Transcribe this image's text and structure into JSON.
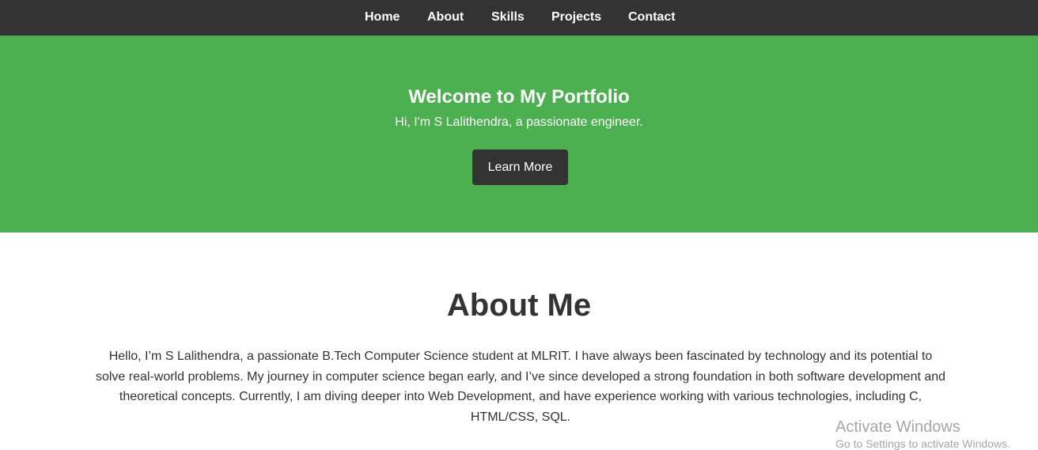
{
  "nav": {
    "items": [
      {
        "label": "Home"
      },
      {
        "label": "About"
      },
      {
        "label": "Skills"
      },
      {
        "label": "Projects"
      },
      {
        "label": "Contact"
      }
    ]
  },
  "hero": {
    "title": "Welcome to My Portfolio",
    "subtitle": "Hi, I'm S Lalithendra, a passionate engineer.",
    "button_label": "Learn More"
  },
  "about": {
    "heading": "About Me",
    "paragraph": "Hello, I’m S Lalithendra, a passionate B.Tech Computer Science student at MLRIT. I have always been fascinated by technology and its potential to solve real-world problems. My journey in computer science began early, and I’ve since developed a strong foundation in both software development and theoretical concepts. Currently, I am diving deeper into Web Development, and have experience working with various technologies, including C, HTML/CSS, SQL."
  },
  "watermark": {
    "title": "Activate Windows",
    "subtitle": "Go to Settings to activate Windows."
  },
  "colors": {
    "nav_background": "#333333",
    "hero_background": "#4caf50",
    "button_background": "#333333",
    "text_dark": "#333333"
  }
}
